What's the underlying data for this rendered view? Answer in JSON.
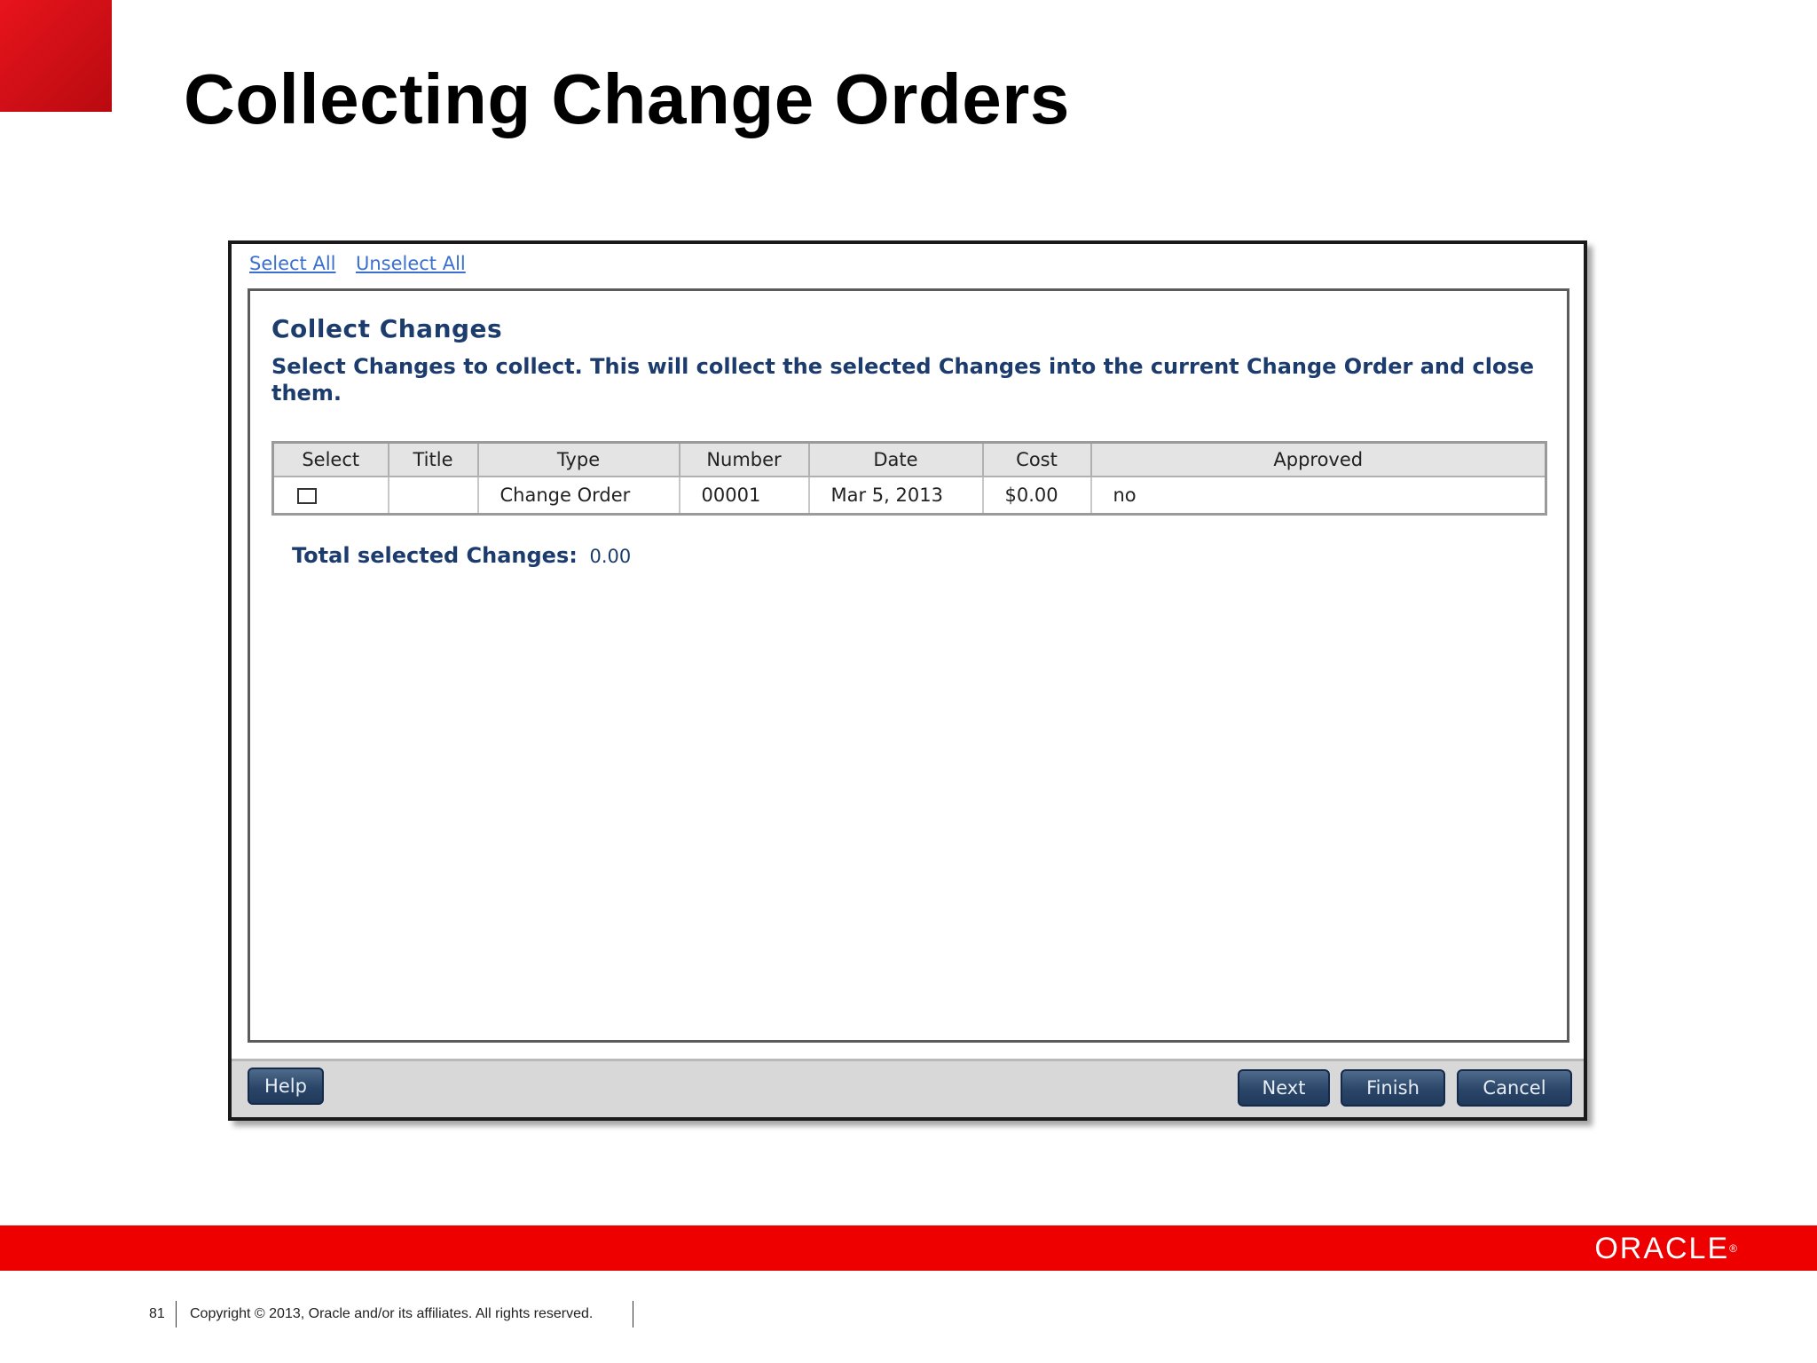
{
  "slide": {
    "title": "Collecting Change Orders",
    "page_number": "81",
    "copyright": "Copyright © 2013, Oracle and/or its affiliates. All rights reserved.",
    "logo_text": "ORACLE",
    "accent_color": "#e8141c"
  },
  "dialog": {
    "links": {
      "select_all": "Select All",
      "unselect_all": "Unselect All"
    },
    "heading": "Collect Changes",
    "description": "Select Changes to collect. This will collect the selected Changes into the current Change Order and close them.",
    "table": {
      "headers": [
        "Select",
        "Title",
        "Type",
        "Number",
        "Date",
        "Cost",
        "Approved"
      ],
      "rows": [
        {
          "selected": false,
          "title": "",
          "type": "Change Order",
          "number": "00001",
          "date": "Mar 5, 2013",
          "cost": "$0.00",
          "approved": "no"
        }
      ]
    },
    "total": {
      "label": "Total selected Changes:",
      "value": "0.00"
    },
    "buttons": {
      "help": "Help",
      "next": "Next",
      "finish": "Finish",
      "cancel": "Cancel"
    }
  }
}
